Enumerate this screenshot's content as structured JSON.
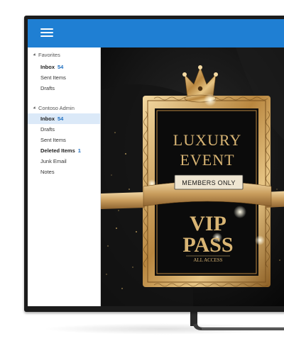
{
  "sidebar": {
    "favorites_label": "Favorites",
    "favorites": [
      {
        "label": "Inbox",
        "count": "54"
      },
      {
        "label": "Sent Items",
        "count": ""
      },
      {
        "label": "Drafts",
        "count": ""
      }
    ],
    "account_label": "Contoso Admin",
    "account_items": [
      {
        "label": "Inbox",
        "count": "54"
      },
      {
        "label": "Drafts",
        "count": ""
      },
      {
        "label": "Sent Items",
        "count": ""
      },
      {
        "label": "Deleted Items",
        "count": "1"
      },
      {
        "label": "Junk Email",
        "count": ""
      },
      {
        "label": "Notes",
        "count": ""
      }
    ]
  },
  "poster": {
    "line1": "LUXURY",
    "line2": "EVENT",
    "ribbon": "MEMBERS ONLY",
    "vip": "VIP",
    "pass": "PASS",
    "all_access": "ALL ACCESS"
  },
  "colors": {
    "appbar": "#1f7fd3",
    "selected_row": "#dbe9f8",
    "count_text": "#1f6fc0",
    "gold": "#c9a15a"
  }
}
